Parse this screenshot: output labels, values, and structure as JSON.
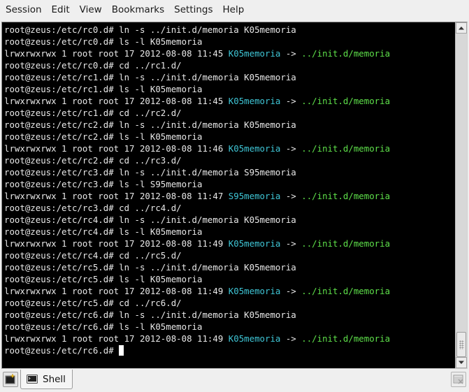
{
  "menubar": {
    "items": [
      "Session",
      "Edit",
      "View",
      "Bookmarks",
      "Settings",
      "Help"
    ]
  },
  "terminal": {
    "lines": [
      {
        "text": "root@zeus:/etc/rc0.d# ln -s ../init.d/memoria K05memoria"
      },
      {
        "text": "root@zeus:/etc/rc0.d# ls -l K05memoria"
      },
      {
        "pre": "lrwxrwxrwx 1 root root 17 2012-08-08 11:45 ",
        "link": "K05memoria",
        "arrow": " -> ",
        "target": "../init.d/memoria"
      },
      {
        "text": "root@zeus:/etc/rc0.d# cd ../rc1.d/"
      },
      {
        "text": "root@zeus:/etc/rc1.d# ln -s ../init.d/memoria K05memoria"
      },
      {
        "text": "root@zeus:/etc/rc1.d# ls -l K05memoria"
      },
      {
        "pre": "lrwxrwxrwx 1 root root 17 2012-08-08 11:45 ",
        "link": "K05memoria",
        "arrow": " -> ",
        "target": "../init.d/memoria"
      },
      {
        "text": "root@zeus:/etc/rc1.d# cd ../rc2.d/"
      },
      {
        "text": "root@zeus:/etc/rc2.d# ln -s ../init.d/memoria K05memoria"
      },
      {
        "text": "root@zeus:/etc/rc2.d# ls -l K05memoria"
      },
      {
        "pre": "lrwxrwxrwx 1 root root 17 2012-08-08 11:46 ",
        "link": "K05memoria",
        "arrow": " -> ",
        "target": "../init.d/memoria"
      },
      {
        "text": "root@zeus:/etc/rc2.d# cd ../rc3.d/"
      },
      {
        "text": "root@zeus:/etc/rc3.d# ln -s ../init.d/memoria S95memoria"
      },
      {
        "text": "root@zeus:/etc/rc3.d# ls -l S95memoria"
      },
      {
        "pre": "lrwxrwxrwx 1 root root 17 2012-08-08 11:47 ",
        "link": "S95memoria",
        "arrow": " -> ",
        "target": "../init.d/memoria"
      },
      {
        "text": "root@zeus:/etc/rc3.d# cd ../rc4.d/"
      },
      {
        "text": "root@zeus:/etc/rc4.d# ln -s ../init.d/memoria K05memoria"
      },
      {
        "text": "root@zeus:/etc/rc4.d# ls -l K05memoria"
      },
      {
        "pre": "lrwxrwxrwx 1 root root 17 2012-08-08 11:49 ",
        "link": "K05memoria",
        "arrow": " -> ",
        "target": "../init.d/memoria"
      },
      {
        "text": "root@zeus:/etc/rc4.d# cd ../rc5.d/"
      },
      {
        "text": "root@zeus:/etc/rc5.d# ln -s ../init.d/memoria K05memoria"
      },
      {
        "text": "root@zeus:/etc/rc5.d# ls -l K05memoria"
      },
      {
        "pre": "lrwxrwxrwx 1 root root 17 2012-08-08 11:49 ",
        "link": "K05memoria",
        "arrow": " -> ",
        "target": "../init.d/memoria"
      },
      {
        "text": "root@zeus:/etc/rc5.d# cd ../rc6.d/"
      },
      {
        "text": "root@zeus:/etc/rc6.d# ln -s ../init.d/memoria K05memoria"
      },
      {
        "text": "root@zeus:/etc/rc6.d# ls -l K05memoria"
      },
      {
        "pre": "lrwxrwxrwx 1 root root 17 2012-08-08 11:49 ",
        "link": "K05memoria",
        "arrow": " -> ",
        "target": "../init.d/memoria"
      }
    ],
    "prompt": "root@zeus:/etc/rc6.d# ",
    "colors": {
      "background": "#000000",
      "foreground": "#e8e8e8",
      "symlink": "#3fc6d6",
      "link_target": "#5ee04a"
    }
  },
  "tabs": [
    {
      "label": "Shell",
      "icon": "terminal-icon",
      "active": true
    }
  ],
  "tabbar": {
    "new_tab_icon": "new-tab-icon",
    "close_tab_icon": "close-tab-icon"
  }
}
